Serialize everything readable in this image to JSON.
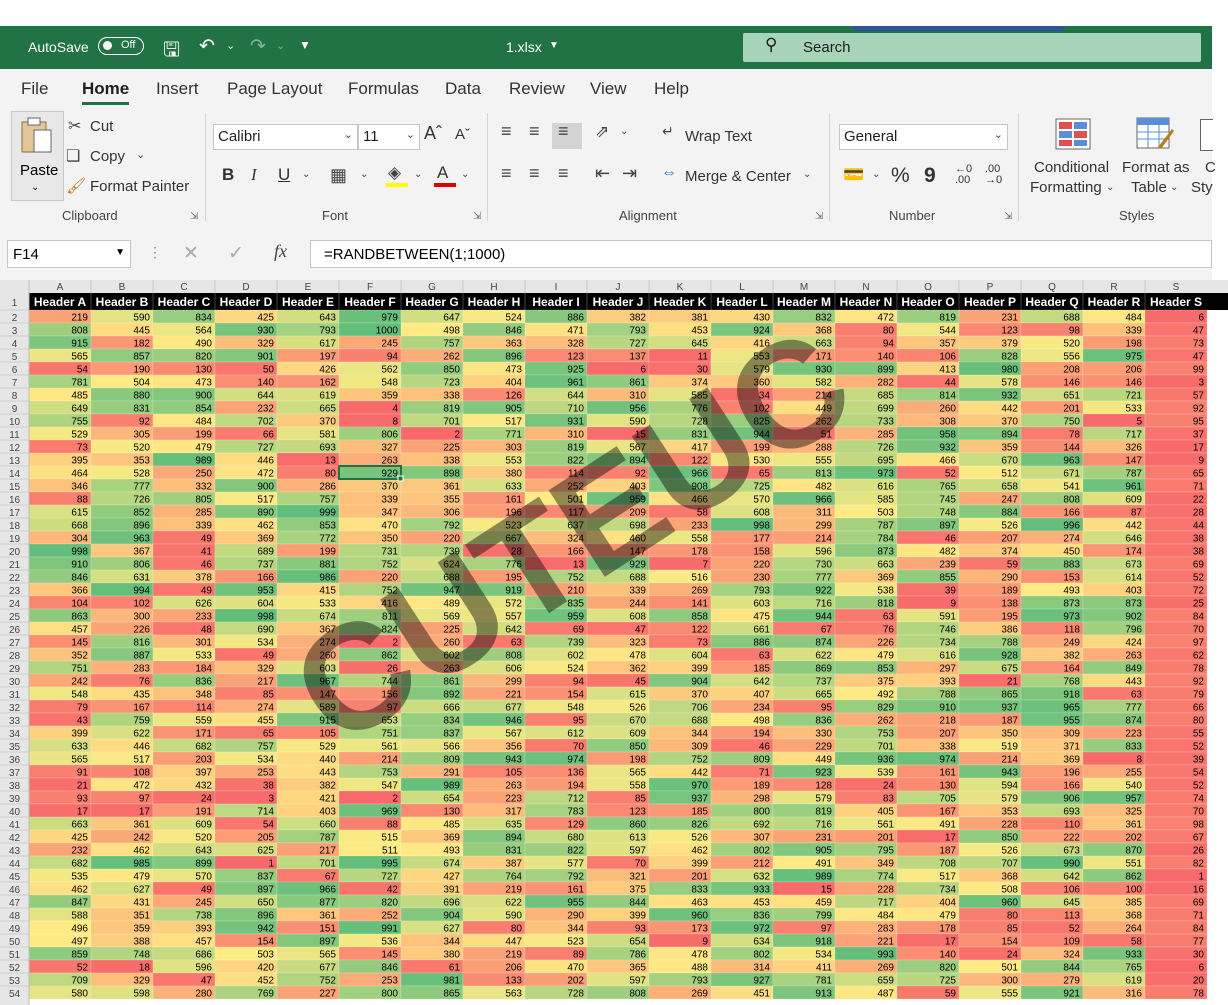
{
  "title_bar": {
    "autosave_label": "AutoSave",
    "autosave_state": "Off",
    "filename": "1.xlsx",
    "search_placeholder": "Search"
  },
  "menu": {
    "tabs": [
      "File",
      "Home",
      "Insert",
      "Page Layout",
      "Formulas",
      "Data",
      "Review",
      "View",
      "Help"
    ],
    "active": "Home"
  },
  "ribbon": {
    "clipboard": {
      "paste": "Paste",
      "cut": "Cut",
      "copy": "Copy",
      "format_painter": "Format Painter",
      "group": "Clipboard"
    },
    "font": {
      "name": "Calibri",
      "size": "11",
      "group": "Font",
      "bold": "B",
      "italic": "I",
      "underline": "U"
    },
    "alignment": {
      "wrap_text": "Wrap Text",
      "merge_center": "Merge & Center",
      "group": "Alignment"
    },
    "number": {
      "format": "General",
      "percent": "%",
      "comma": "9",
      "group": "Number"
    },
    "styles": {
      "conditional_1": "Conditional",
      "conditional_2": "Formatting",
      "format_table_1": "Format as",
      "format_table_2": "Table",
      "group": "Styles"
    }
  },
  "formula_bar": {
    "name_box": "F14",
    "formula": "=RANDBETWEEN(1;1000)",
    "fx": "fx"
  },
  "sheet": {
    "columns": [
      "A",
      "B",
      "C",
      "D",
      "E",
      "F",
      "G",
      "H",
      "I",
      "J",
      "K",
      "L",
      "M",
      "N",
      "O",
      "P",
      "Q",
      "R",
      "S"
    ],
    "headers": [
      "Header A",
      "Header B",
      "Header C",
      "Header D",
      "Header E",
      "Header F",
      "Header G",
      "Header H",
      "Header I",
      "Header J",
      "Header K",
      "Header L",
      "Header M",
      "Header N",
      "Header O",
      "Header P",
      "Header Q",
      "Header R",
      "Header S"
    ],
    "first_data_row": 2,
    "selected_cell": "F14",
    "color_scale": {
      "low": "#f8696b",
      "mid": "#ffeb84",
      "high": "#63be7b"
    },
    "watermark": "CUTEUC",
    "rows": [
      [
        219,
        590,
        834,
        425,
        643,
        979,
        647,
        524,
        886,
        382,
        381,
        430,
        832,
        472,
        819,
        231,
        688,
        484,
        6
      ],
      [
        808,
        445,
        564,
        930,
        793,
        1000,
        498,
        846,
        471,
        793,
        453,
        924,
        368,
        80,
        544,
        123,
        98,
        339,
        47
      ],
      [
        915,
        182,
        490,
        329,
        617,
        245,
        757,
        363,
        328,
        727,
        645,
        416,
        663,
        94,
        357,
        379,
        520,
        198,
        73
      ],
      [
        565,
        857,
        820,
        901,
        197,
        94,
        262,
        896,
        123,
        137,
        11,
        553,
        171,
        140,
        106,
        828,
        556,
        975,
        47
      ],
      [
        54,
        190,
        130,
        50,
        426,
        562,
        850,
        473,
        925,
        6,
        30,
        579,
        930,
        899,
        413,
        980,
        208,
        206,
        99
      ],
      [
        781,
        504,
        473,
        140,
        162,
        548,
        723,
        404,
        961,
        861,
        374,
        360,
        582,
        282,
        44,
        578,
        146,
        146,
        3
      ],
      [
        485,
        880,
        900,
        644,
        619,
        359,
        338,
        126,
        644,
        310,
        585,
        34,
        214,
        685,
        814,
        932,
        651,
        721,
        57
      ],
      [
        649,
        831,
        854,
        232,
        665,
        4,
        819,
        905,
        710,
        956,
        776,
        102,
        449,
        699,
        260,
        442,
        201,
        533,
        92
      ],
      [
        755,
        92,
        484,
        702,
        370,
        8,
        701,
        517,
        931,
        590,
        728,
        825,
        262,
        733,
        308,
        370,
        750,
        5,
        95
      ],
      [
        529,
        305,
        199,
        66,
        581,
        806,
        2,
        771,
        310,
        15,
        831,
        944,
        51,
        285,
        958,
        894,
        78,
        717,
        37
      ],
      [
        73,
        520,
        479,
        727,
        693,
        327,
        225,
        303,
        819,
        567,
        417,
        199,
        288,
        726,
        932,
        359,
        144,
        326,
        17
      ],
      [
        395,
        353,
        989,
        446,
        13,
        263,
        338,
        553,
        822,
        894,
        122,
        530,
        555,
        695,
        466,
        670,
        963,
        147,
        9
      ],
      [
        464,
        528,
        250,
        472,
        80,
        929,
        898,
        380,
        114,
        92,
        966,
        65,
        813,
        973,
        52,
        512,
        671,
        787,
        65
      ],
      [
        346,
        777,
        332,
        900,
        286,
        370,
        361,
        633,
        252,
        403,
        908,
        725,
        482,
        616,
        765,
        658,
        541,
        961,
        71
      ],
      [
        88,
        726,
        805,
        517,
        757,
        339,
        355,
        161,
        501,
        959,
        466,
        570,
        966,
        585,
        745,
        247,
        808,
        609,
        22
      ],
      [
        615,
        852,
        285,
        890,
        999,
        347,
        306,
        196,
        117,
        209,
        58,
        608,
        311,
        503,
        748,
        884,
        166,
        87,
        28
      ],
      [
        668,
        896,
        339,
        462,
        853,
        470,
        792,
        523,
        637,
        698,
        233,
        998,
        299,
        787,
        897,
        526,
        996,
        442,
        44
      ],
      [
        304,
        963,
        49,
        369,
        772,
        350,
        220,
        667,
        324,
        460,
        558,
        177,
        214,
        784,
        46,
        207,
        274,
        646,
        38
      ],
      [
        998,
        367,
        41,
        689,
        199,
        731,
        739,
        28,
        166,
        147,
        178,
        158,
        596,
        873,
        482,
        374,
        450,
        174,
        38
      ],
      [
        910,
        806,
        46,
        737,
        881,
        752,
        624,
        776,
        13,
        929,
        7,
        220,
        730,
        663,
        239,
        59,
        883,
        673,
        69
      ],
      [
        846,
        631,
        378,
        166,
        986,
        220,
        688,
        195,
        752,
        688,
        516,
        230,
        777,
        369,
        855,
        290,
        153,
        614,
        52
      ],
      [
        366,
        994,
        49,
        953,
        415,
        752,
        947,
        919,
        210,
        339,
        269,
        793,
        922,
        538,
        39,
        189,
        493,
        403,
        72
      ],
      [
        104,
        102,
        626,
        604,
        533,
        416,
        489,
        572,
        835,
        244,
        141,
        603,
        716,
        818,
        9,
        138,
        873,
        873,
        25
      ],
      [
        863,
        300,
        233,
        998,
        674,
        811,
        569,
        557,
        959,
        608,
        858,
        475,
        944,
        63,
        591,
        195,
        973,
        902,
        84
      ],
      [
        457,
        226,
        48,
        690,
        367,
        824,
        225,
        642,
        69,
        47,
        122,
        661,
        67,
        76,
        746,
        386,
        118,
        796,
        70
      ],
      [
        145,
        816,
        301,
        534,
        274,
        2,
        260,
        63,
        739,
        323,
        73,
        886,
        874,
        226,
        734,
        788,
        249,
        424,
        97
      ],
      [
        352,
        887,
        533,
        49,
        260,
        862,
        602,
        808,
        602,
        478,
        604,
        63,
        622,
        479,
        616,
        928,
        382,
        263,
        62
      ],
      [
        751,
        283,
        184,
        329,
        603,
        26,
        263,
        606,
        524,
        362,
        399,
        185,
        869,
        853,
        297,
        675,
        164,
        849,
        78
      ],
      [
        242,
        76,
        836,
        217,
        967,
        744,
        861,
        299,
        94,
        45,
        904,
        642,
        737,
        375,
        393,
        21,
        768,
        443,
        92
      ],
      [
        548,
        435,
        348,
        85,
        147,
        156,
        892,
        221,
        154,
        615,
        370,
        407,
        665,
        492,
        788,
        865,
        918,
        63,
        79
      ],
      [
        79,
        167,
        114,
        274,
        589,
        97,
        666,
        677,
        548,
        526,
        706,
        234,
        95,
        829,
        910,
        937,
        965,
        777,
        66
      ],
      [
        43,
        759,
        559,
        455,
        915,
        653,
        834,
        946,
        95,
        670,
        688,
        498,
        836,
        262,
        218,
        187,
        955,
        874,
        80
      ],
      [
        399,
        622,
        171,
        65,
        105,
        751,
        837,
        567,
        612,
        609,
        344,
        194,
        330,
        753,
        207,
        350,
        309,
        223,
        55
      ],
      [
        633,
        446,
        682,
        757,
        529,
        561,
        566,
        356,
        70,
        850,
        309,
        46,
        229,
        701,
        338,
        519,
        371,
        833,
        52
      ],
      [
        565,
        517,
        203,
        534,
        440,
        214,
        809,
        943,
        974,
        198,
        752,
        809,
        449,
        936,
        974,
        214,
        369,
        8,
        39
      ],
      [
        91,
        108,
        397,
        253,
        443,
        753,
        291,
        105,
        136,
        565,
        442,
        71,
        923,
        539,
        161,
        943,
        196,
        255,
        54
      ],
      [
        21,
        472,
        432,
        38,
        382,
        547,
        989,
        263,
        194,
        558,
        970,
        189,
        128,
        24,
        130,
        594,
        166,
        540,
        52
      ],
      [
        93,
        97,
        24,
        3,
        421,
        2,
        654,
        223,
        712,
        85,
        937,
        298,
        579,
        83,
        705,
        579,
        906,
        957,
        74
      ],
      [
        17,
        17,
        191,
        714,
        403,
        969,
        130,
        317,
        783,
        123,
        185,
        800,
        819,
        405,
        167,
        353,
        693,
        325,
        70
      ],
      [
        663,
        361,
        609,
        54,
        660,
        88,
        485,
        635,
        129,
        860,
        826,
        692,
        716,
        561,
        491,
        228,
        110,
        361,
        98
      ],
      [
        425,
        242,
        520,
        205,
        787,
        515,
        369,
        894,
        680,
        613,
        526,
        307,
        231,
        201,
        17,
        850,
        222,
        202,
        67
      ],
      [
        232,
        462,
        643,
        625,
        217,
        511,
        493,
        831,
        822,
        597,
        462,
        802,
        905,
        795,
        187,
        526,
        673,
        870,
        26
      ],
      [
        682,
        985,
        899,
        1,
        701,
        995,
        674,
        387,
        577,
        70,
        399,
        212,
        491,
        349,
        708,
        707,
        990,
        551,
        82
      ],
      [
        535,
        479,
        570,
        837,
        67,
        727,
        427,
        764,
        792,
        321,
        201,
        632,
        989,
        774,
        517,
        368,
        642,
        862,
        1
      ],
      [
        462,
        627,
        49,
        897,
        966,
        42,
        391,
        219,
        161,
        375,
        833,
        933,
        15,
        228,
        734,
        508,
        106,
        100,
        16
      ],
      [
        847,
        431,
        245,
        650,
        877,
        820,
        696,
        622,
        955,
        844,
        463,
        453,
        459,
        717,
        404,
        960,
        645,
        385,
        69
      ],
      [
        588,
        351,
        738,
        896,
        361,
        252,
        904,
        590,
        290,
        399,
        960,
        836,
        799,
        484,
        479,
        80,
        113,
        368,
        71
      ],
      [
        496,
        359,
        393,
        942,
        151,
        991,
        627,
        80,
        344,
        93,
        173,
        972,
        97,
        283,
        178,
        85,
        52,
        264,
        84
      ],
      [
        497,
        388,
        457,
        154,
        897,
        536,
        344,
        447,
        523,
        654,
        9,
        634,
        918,
        221,
        17,
        154,
        109,
        58,
        77
      ],
      [
        859,
        748,
        686,
        503,
        565,
        145,
        380,
        219,
        89,
        786,
        478,
        802,
        534,
        993,
        140,
        24,
        324,
        933,
        30
      ],
      [
        52,
        18,
        596,
        420,
        677,
        846,
        61,
        206,
        470,
        365,
        488,
        314,
        411,
        269,
        820,
        501,
        844,
        765,
        6
      ],
      [
        709,
        329,
        47,
        452,
        752,
        253,
        981,
        133,
        202,
        597,
        793,
        927,
        781,
        659,
        725,
        300,
        279,
        619,
        20
      ],
      [
        580,
        598,
        280,
        769,
        227,
        800,
        865,
        563,
        728,
        808,
        269,
        451,
        913,
        487,
        59,
        555,
        921,
        316,
        78
      ]
    ]
  }
}
